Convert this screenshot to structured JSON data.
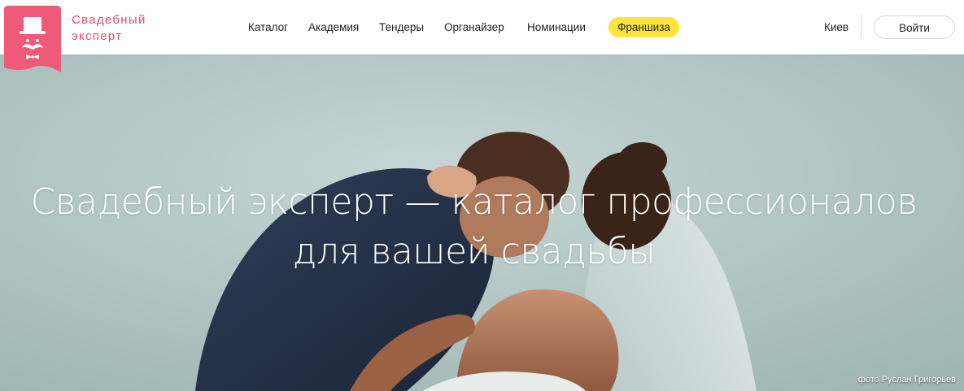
{
  "brand": {
    "line1": "Свадебный",
    "line2": "эксперт",
    "color": "#e94a6a"
  },
  "nav": {
    "items": [
      {
        "label": "Каталог"
      },
      {
        "label": "Академия"
      },
      {
        "label": "Тендеры"
      },
      {
        "label": "Органайзер"
      },
      {
        "label": "Номинации"
      }
    ],
    "highlight": {
      "label": "Франшиза",
      "color": "#fce43a"
    }
  },
  "header_right": {
    "city": "Киев",
    "login_label": "Войти"
  },
  "hero": {
    "title_line1": "Свадебный эксперт — каталог профессионалов",
    "title_line2": "для вашей свадьбы",
    "photo_credit": "фото Руслан Григорьев"
  }
}
